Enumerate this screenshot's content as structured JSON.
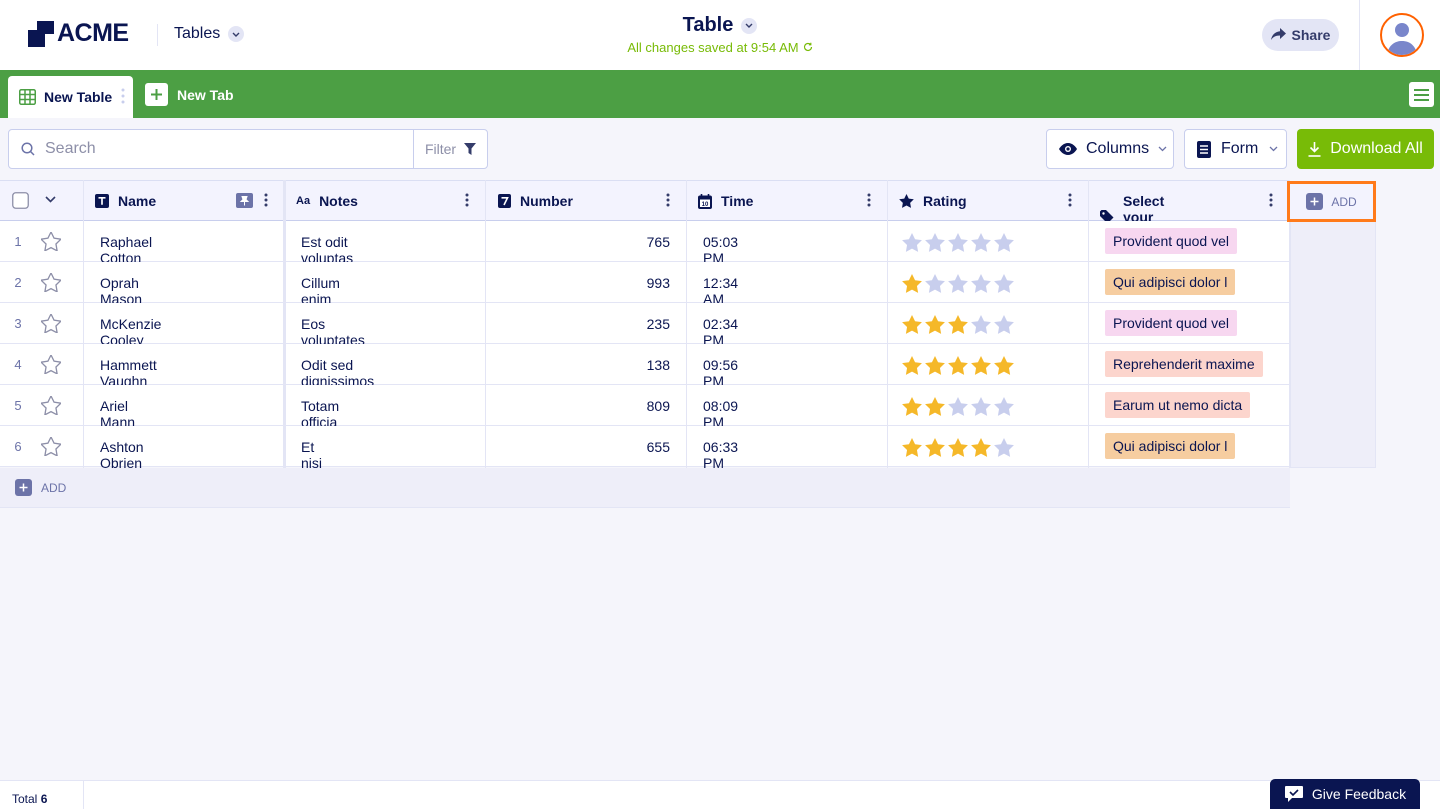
{
  "header": {
    "logo_text": "ACME",
    "tables_menu_label": "Tables",
    "title": "Table",
    "save_status": "All changes saved at 9:54 AM",
    "share_label": "Share"
  },
  "tabs": {
    "active_label": "New Table",
    "new_tab_label": "New Tab"
  },
  "toolbar": {
    "search_placeholder": "Search",
    "filter_label": "Filter",
    "columns_label": "Columns",
    "form_label": "Form",
    "download_label": "Download All"
  },
  "table": {
    "columns": [
      "Name",
      "Notes",
      "Number",
      "Time",
      "Rating",
      "Select your option"
    ],
    "add_column_label": "ADD",
    "add_row_label": "ADD",
    "rows": [
      {
        "num": "1",
        "name": "Raphael Cotton",
        "notes": "Est odit voluptas do",
        "number": "765",
        "time": "05:03 PM",
        "rating": 0,
        "option": "Provident quod vel",
        "option_color": "#f7d7f0"
      },
      {
        "num": "2",
        "name": "Oprah Mason",
        "notes": "Cillum enim voluptat",
        "number": "993",
        "time": "12:34 AM",
        "rating": 1,
        "option": "Qui adipisci dolor l",
        "option_color": "#f6cda0"
      },
      {
        "num": "3",
        "name": "McKenzie Cooley",
        "notes": "Eos voluptates occa",
        "number": "235",
        "time": "02:34 PM",
        "rating": 3,
        "option": "Provident quod vel",
        "option_color": "#f7d7f0"
      },
      {
        "num": "4",
        "name": "Hammett Vaughn",
        "notes": "Odit sed dignissimos",
        "number": "138",
        "time": "09:56 PM",
        "rating": 5,
        "option": "Reprehenderit maxime",
        "option_color": "#fcd5cd"
      },
      {
        "num": "5",
        "name": "Ariel Mann",
        "notes": "Totam officia nemo q",
        "number": "809",
        "time": "08:09 PM",
        "rating": 2,
        "option": "Earum ut nemo dicta",
        "option_color": "#fcd5cd"
      },
      {
        "num": "6",
        "name": "Ashton Obrien",
        "notes": "Et nisi rerum debiti",
        "number": "655",
        "time": "06:33 PM",
        "rating": 4,
        "option": "Qui adipisci dolor l",
        "option_color": "#f6cda0"
      }
    ]
  },
  "footer": {
    "total_label": "Total",
    "total_count": "6",
    "feedback_label": "Give Feedback"
  },
  "colors": {
    "navy": "#0a1551",
    "tabbar_green": "#4c9f44",
    "download_green": "#78bb07",
    "star_filled": "#f5b829",
    "star_empty": "#c8ceed",
    "highlight_orange": "#ff7a1a"
  }
}
